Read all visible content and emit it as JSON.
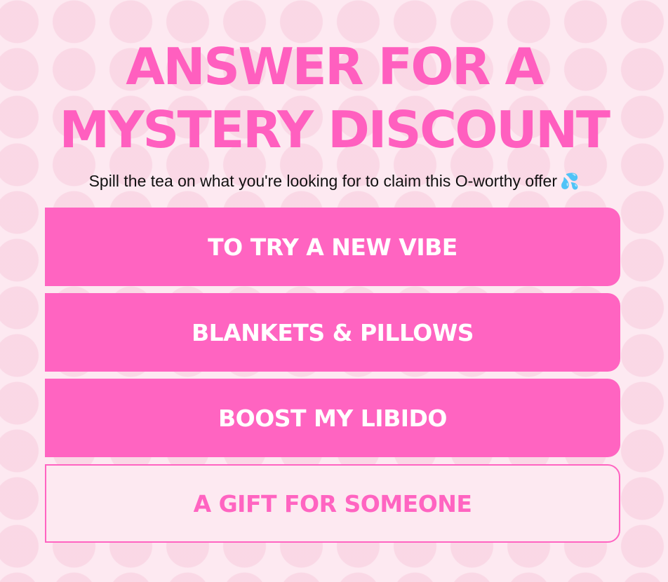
{
  "headline": "ANSWER FOR A MYSTERY DISCOUNT",
  "subtitle": {
    "text": "Spill the tea on what you're looking for to claim this O-worthy offer",
    "emoji": "💦",
    "emoji_icon": "sweat-droplets-icon"
  },
  "options": [
    {
      "label": "TO TRY A NEW VIBE",
      "style": "filled"
    },
    {
      "label": "BLANKETS & PILLOWS",
      "style": "filled"
    },
    {
      "label": "BOOST MY LIBIDO",
      "style": "filled"
    },
    {
      "label": "A GIFT FOR SOMEONE",
      "style": "outlined"
    }
  ],
  "colors": {
    "accent": "#ff64c1",
    "background": "#fde9f1",
    "dot_pattern": "#f6c4d8",
    "text": "#111111"
  }
}
